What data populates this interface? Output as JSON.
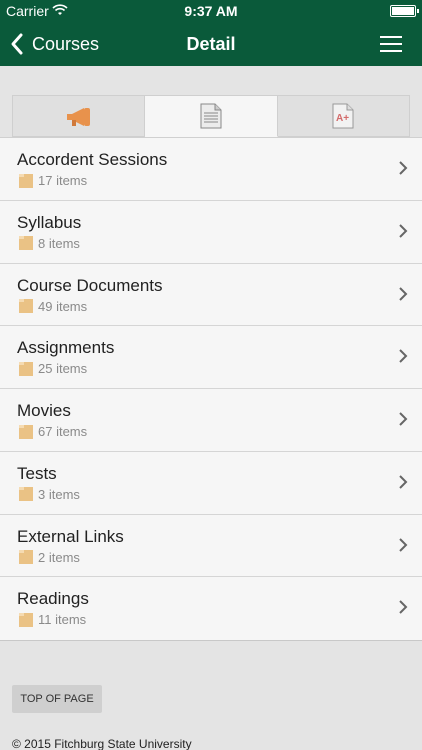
{
  "status": {
    "carrier": "Carrier",
    "time": "9:37 AM"
  },
  "nav": {
    "back_label": "Courses",
    "title": "Detail"
  },
  "tabs": [
    {
      "icon": "megaphone-icon",
      "active": false
    },
    {
      "icon": "document-icon",
      "active": true
    },
    {
      "icon": "grade-icon",
      "active": false
    }
  ],
  "list": [
    {
      "title": "Accordent Sessions",
      "count": "17 items"
    },
    {
      "title": "Syllabus",
      "count": "8 items"
    },
    {
      "title": "Course Documents",
      "count": "49 items"
    },
    {
      "title": "Assignments",
      "count": "25 items"
    },
    {
      "title": "Movies",
      "count": "67 items"
    },
    {
      "title": "Tests",
      "count": "3 items"
    },
    {
      "title": "External Links",
      "count": "2 items"
    },
    {
      "title": "Readings",
      "count": "11 items"
    }
  ],
  "top_button": "TOP OF PAGE",
  "footer": "© 2015 Fitchburg State University",
  "colors": {
    "header": "#0a5a3a",
    "folder": "#eac285"
  }
}
